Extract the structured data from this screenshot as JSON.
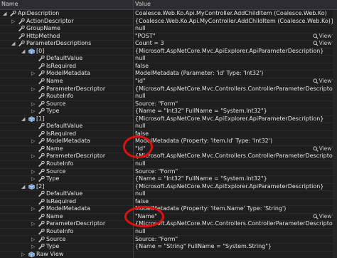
{
  "columns": {
    "name": "Name",
    "value": "Value"
  },
  "view_label": "View",
  "rows": [
    {
      "depth": 0,
      "exp": "open",
      "icon": "wrench",
      "name": "ApiDescription",
      "value": "Coalesce.Web.Ko.Api.MyController.AddChildItem (Coalesce.Web.Ko)",
      "view": false
    },
    {
      "depth": 1,
      "exp": "closed",
      "icon": "wrench",
      "name": "ActionDescriptor",
      "value": "{Coalesce.Web.Ko.Api.MyController.AddChildItem (Coalesce.Web.Ko)}",
      "view": false
    },
    {
      "depth": 1,
      "exp": "none",
      "icon": "wrench",
      "name": "GroupName",
      "value": "null",
      "view": false
    },
    {
      "depth": 1,
      "exp": "none",
      "icon": "wrench",
      "name": "HttpMethod",
      "value": "\"POST\"",
      "view": true
    },
    {
      "depth": 1,
      "exp": "open",
      "icon": "wrench",
      "name": "ParameterDescriptions",
      "value": "Count = 3",
      "view": true
    },
    {
      "depth": 2,
      "exp": "open",
      "icon": "cube",
      "name": "[0]",
      "value": "{Microsoft.AspNetCore.Mvc.ApiExplorer.ApiParameterDescription}",
      "view": false
    },
    {
      "depth": 3,
      "exp": "none",
      "icon": "wrench",
      "name": "DefaultValue",
      "value": "null",
      "view": false
    },
    {
      "depth": 3,
      "exp": "none",
      "icon": "wrench",
      "name": "IsRequired",
      "value": "false",
      "view": false
    },
    {
      "depth": 3,
      "exp": "closed",
      "icon": "wrench",
      "name": "ModelMetadata",
      "value": "ModelMetadata (Parameter: 'id' Type: 'Int32')",
      "view": false
    },
    {
      "depth": 3,
      "exp": "none",
      "icon": "wrench",
      "name": "Name",
      "value": "\"id\"",
      "view": true
    },
    {
      "depth": 3,
      "exp": "closed",
      "icon": "wrench",
      "name": "ParameterDescriptor",
      "value": "{Microsoft.AspNetCore.Mvc.Controllers.ControllerParameterDescriptor}",
      "view": false
    },
    {
      "depth": 3,
      "exp": "none",
      "icon": "wrench",
      "name": "RouteInfo",
      "value": "null",
      "view": false
    },
    {
      "depth": 3,
      "exp": "closed",
      "icon": "wrench",
      "name": "Source",
      "value": "Source: \"Form\"",
      "view": false
    },
    {
      "depth": 3,
      "exp": "closed",
      "icon": "wrench",
      "name": "Type",
      "value": "{Name = \"Int32\" FullName = \"System.Int32\"}",
      "view": false
    },
    {
      "depth": 2,
      "exp": "open",
      "icon": "cube",
      "name": "[1]",
      "value": "{Microsoft.AspNetCore.Mvc.ApiExplorer.ApiParameterDescription}",
      "view": false
    },
    {
      "depth": 3,
      "exp": "none",
      "icon": "wrench",
      "name": "DefaultValue",
      "value": "null",
      "view": false
    },
    {
      "depth": 3,
      "exp": "none",
      "icon": "wrench",
      "name": "IsRequired",
      "value": "false",
      "view": false
    },
    {
      "depth": 3,
      "exp": "closed",
      "icon": "wrench",
      "name": "ModelMetadata",
      "value": "ModelMetadata (Property: 'Item.Id' Type: 'Int32')",
      "view": false
    },
    {
      "depth": 3,
      "exp": "none",
      "icon": "wrench",
      "name": "Name",
      "value": "\"Id\"",
      "view": true
    },
    {
      "depth": 3,
      "exp": "closed",
      "icon": "wrench",
      "name": "ParameterDescriptor",
      "value": "{Microsoft.AspNetCore.Mvc.Controllers.ControllerParameterDescriptor}",
      "view": false
    },
    {
      "depth": 3,
      "exp": "none",
      "icon": "wrench",
      "name": "RouteInfo",
      "value": "null",
      "view": false
    },
    {
      "depth": 3,
      "exp": "closed",
      "icon": "wrench",
      "name": "Source",
      "value": "Source: \"Form\"",
      "view": false
    },
    {
      "depth": 3,
      "exp": "closed",
      "icon": "wrench",
      "name": "Type",
      "value": "{Name = \"Int32\" FullName = \"System.Int32\"}",
      "view": false
    },
    {
      "depth": 2,
      "exp": "open",
      "icon": "cube",
      "name": "[2]",
      "value": "{Microsoft.AspNetCore.Mvc.ApiExplorer.ApiParameterDescription}",
      "view": false
    },
    {
      "depth": 3,
      "exp": "none",
      "icon": "wrench",
      "name": "DefaultValue",
      "value": "null",
      "view": false
    },
    {
      "depth": 3,
      "exp": "none",
      "icon": "wrench",
      "name": "IsRequired",
      "value": "false",
      "view": false
    },
    {
      "depth": 3,
      "exp": "closed",
      "icon": "wrench",
      "name": "ModelMetadata",
      "value": "ModelMetadata (Property: 'Item.Name' Type: 'String')",
      "view": false
    },
    {
      "depth": 3,
      "exp": "none",
      "icon": "wrench",
      "name": "Name",
      "value": "\"Name\"",
      "view": true
    },
    {
      "depth": 3,
      "exp": "closed",
      "icon": "wrench",
      "name": "ParameterDescriptor",
      "value": "{Microsoft.AspNetCore.Mvc.Controllers.ControllerParameterDescriptor}",
      "view": false
    },
    {
      "depth": 3,
      "exp": "none",
      "icon": "wrench",
      "name": "RouteInfo",
      "value": "null",
      "view": false
    },
    {
      "depth": 3,
      "exp": "closed",
      "icon": "wrench",
      "name": "Source",
      "value": "Source: \"Form\"",
      "view": false
    },
    {
      "depth": 3,
      "exp": "closed",
      "icon": "wrench",
      "name": "Type",
      "value": "{Name = \"String\" FullName = \"System.String\"}",
      "view": false
    },
    {
      "depth": 2,
      "exp": "closed",
      "icon": "cube",
      "name": "Raw View",
      "value": "",
      "view": false
    }
  ]
}
